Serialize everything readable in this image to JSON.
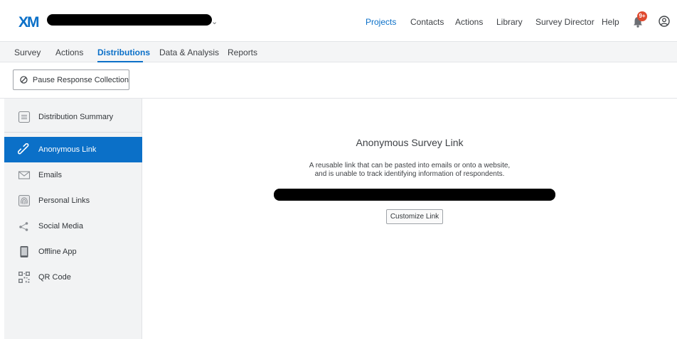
{
  "header": {
    "logo": "XM",
    "nav": [
      {
        "label": "Projects",
        "active": true
      },
      {
        "label": "Contacts"
      },
      {
        "label": "Actions"
      },
      {
        "label": "Library"
      },
      {
        "label": "Survey Director"
      },
      {
        "label": "Help"
      }
    ],
    "notification_count": "9+",
    "icons": {
      "project_dropdown": "chevron-down-icon",
      "notifications": "bell-icon",
      "account": "user-circle-icon"
    }
  },
  "subnav": {
    "tabs": [
      {
        "label": "Survey"
      },
      {
        "label": "Actions"
      },
      {
        "label": "Distributions",
        "active": true
      },
      {
        "label": "Data & Analysis"
      },
      {
        "label": "Reports"
      }
    ]
  },
  "toolbar": {
    "pause_label": "Pause Response Collection",
    "pause_icon": "ban-icon"
  },
  "sidebar": {
    "items": [
      {
        "label": "Distribution Summary",
        "icon": "document-icon"
      },
      {
        "label": "Anonymous Link",
        "icon": "link-icon",
        "active": true
      },
      {
        "label": "Emails",
        "icon": "envelope-icon"
      },
      {
        "label": "Personal Links",
        "icon": "fingerprint-icon"
      },
      {
        "label": "Social Media",
        "icon": "share-icon"
      },
      {
        "label": "Offline App",
        "icon": "tablet-icon"
      },
      {
        "label": "QR Code",
        "icon": "qr-code-icon"
      }
    ]
  },
  "main": {
    "title": "Anonymous Survey Link",
    "description_line1": "A reusable link that can be pasted into emails or onto a website,",
    "description_line2": "and is unable to track identifying information of respondents.",
    "customize_label": "Customize Link"
  },
  "colors": {
    "accent": "#0b70c8",
    "badge": "#e04a2f",
    "sidebar_bg": "#f2f3f4"
  }
}
